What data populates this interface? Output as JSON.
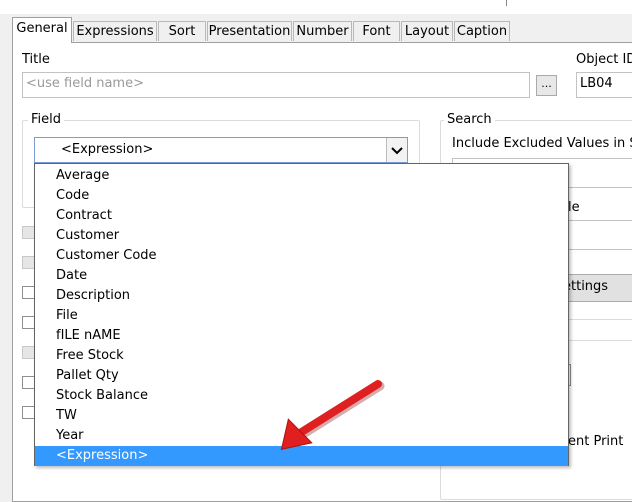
{
  "tabs": [
    {
      "label": "General",
      "active": true
    },
    {
      "label": "Expressions"
    },
    {
      "label": "Sort"
    },
    {
      "label": "Presentation"
    },
    {
      "label": "Number"
    },
    {
      "label": "Font"
    },
    {
      "label": "Layout"
    },
    {
      "label": "Caption"
    }
  ],
  "title_label": "Title",
  "title_placeholder": "<use field name>",
  "ellipsis_label": "...",
  "object_id_label": "Object ID",
  "object_id_value": "LB04",
  "field_group_label": "Field",
  "field_selected": "<Expression>",
  "search_group_label": "Search",
  "include_excluded_label": "Include Excluded Values in Se",
  "partial_label_1": "le",
  "partial_label_2": "ent Print",
  "settings_button_label": "ettings",
  "field_options": [
    "Average",
    "Code",
    "Contract",
    "Customer",
    "Customer Code",
    "Date",
    "Description",
    "File",
    "fILE nAME",
    "Free Stock",
    "Pallet Qty",
    "Stock Balance",
    "TW",
    "Year",
    "<Expression>"
  ],
  "selected_option_index": 14,
  "colors": {
    "selection": "#3399ff",
    "arrow": "#e02020"
  },
  "icons": {
    "dropdown": "chevron-down-icon",
    "annotation": "red-arrow-icon"
  }
}
